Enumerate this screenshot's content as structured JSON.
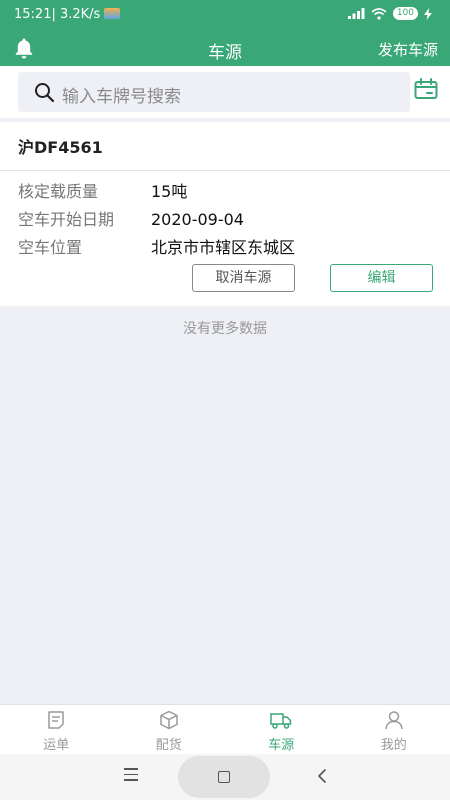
{
  "status_bar": {
    "time": "15:21",
    "speed": "| 3.2K/s",
    "battery": "100"
  },
  "header": {
    "title": "车源",
    "publish_label": "发布车源"
  },
  "search": {
    "placeholder": "输入车牌号搜索"
  },
  "vehicle": {
    "plate": "沪DF4561",
    "fields": [
      {
        "label": "核定载质量",
        "value": "15吨"
      },
      {
        "label": "空车开始日期",
        "value": "2020-09-04"
      },
      {
        "label": "空车位置",
        "value": "北京市市辖区东城区"
      }
    ],
    "cancel_label": "取消车源",
    "edit_label": "编辑"
  },
  "list": {
    "empty_text": "没有更多数据"
  },
  "tabbar": {
    "items": [
      {
        "label": "运单",
        "icon": "document-icon"
      },
      {
        "label": "配货",
        "icon": "box-icon"
      },
      {
        "label": "车源",
        "icon": "truck-icon"
      },
      {
        "label": "我的",
        "icon": "user-icon"
      }
    ],
    "active": "车源"
  },
  "colors": {
    "brand": "#3aa776",
    "background": "#eef0f6"
  }
}
